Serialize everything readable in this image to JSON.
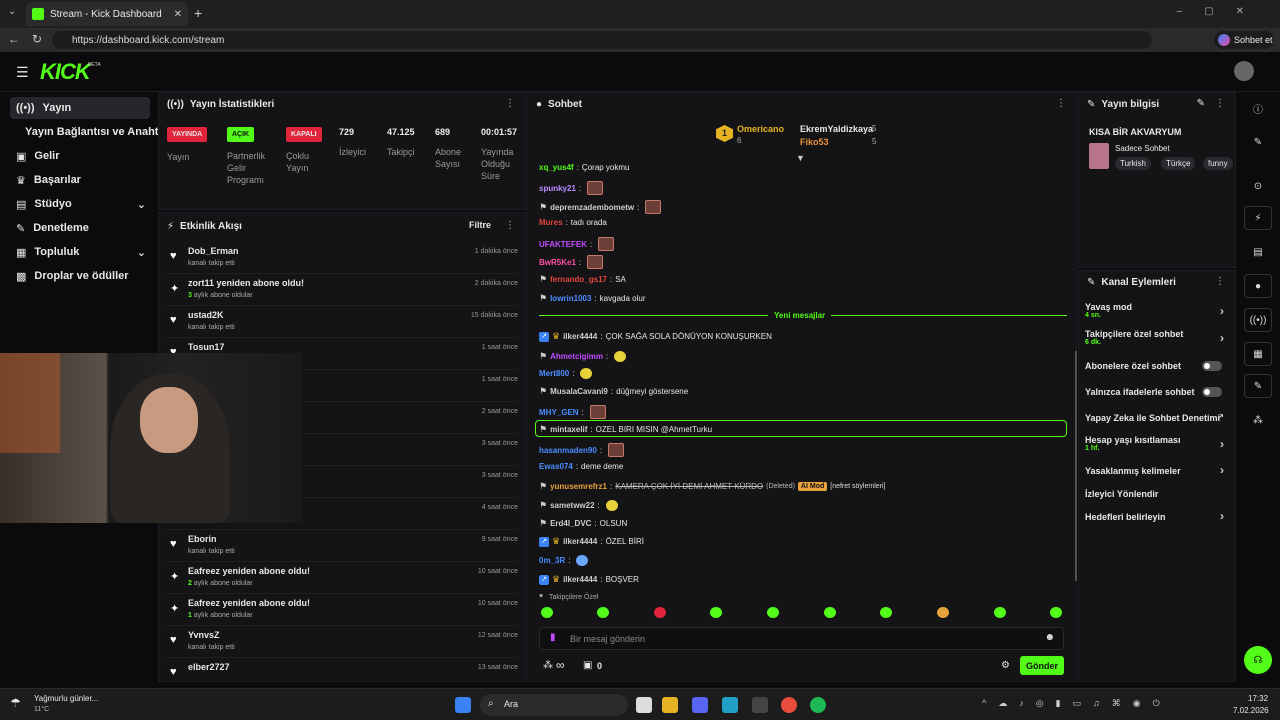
{
  "browser": {
    "tab_title": "Stream - Kick Dashboard",
    "url": "https://dashboard.kick.com/stream",
    "profile_label": "Sohbet et"
  },
  "brand": {
    "logo": "KICK",
    "beta": "BETA",
    "accent": "#53fc18"
  },
  "sidebar": {
    "items": [
      {
        "label": "Yayın",
        "icon": "broadcast-icon"
      },
      {
        "label": "Yayın Bağlantısı ve Anahtarı",
        "icon": ""
      },
      {
        "label": "Gelir",
        "icon": "revenue-icon"
      },
      {
        "label": "Başarılar",
        "icon": "trophy-icon"
      },
      {
        "label": "Stüdyo",
        "icon": "studio-icon"
      },
      {
        "label": "Denetleme",
        "icon": "wrench-icon"
      },
      {
        "label": "Topluluk",
        "icon": "community-icon"
      },
      {
        "label": "Droplar ve ödüller",
        "icon": "gift-icon"
      }
    ]
  },
  "stats": {
    "title": "Yayın İstatistikleri",
    "stream_badge": "YAYINDA",
    "stream_label": "Yayın",
    "partner_badge": "AÇIK",
    "partner_label": "Partnerlik Gelir Programı",
    "multi_badge": "KAPALI",
    "multi_label": "Çoklu Yayın",
    "viewers": "729",
    "viewers_label": "İzleyici",
    "followers": "47.125",
    "followers_label": "Takipçi",
    "subs": "689",
    "subs_label": "Abone Sayısı",
    "uptime": "00:01:57",
    "uptime_label": "Yayında Olduğu Süre"
  },
  "activity": {
    "title": "Etkinlik Akışı",
    "filter": "Filtre",
    "items": [
      {
        "name": "Dob_Erman",
        "sub": "kanalı takip etti",
        "time": "1 dakika önce",
        "icon": "heart"
      },
      {
        "name": "zort11 yeniden abone oldu!",
        "sub": "aylık abone oldular",
        "months": "3",
        "time": "2 dakika önce",
        "icon": "star"
      },
      {
        "name": "ustad2K",
        "sub": "kanalı takip etti",
        "time": "15 dakika önce",
        "icon": "heart"
      },
      {
        "name": "Tosun17",
        "sub": "",
        "time": "1 saat önce",
        "icon": "heart"
      },
      {
        "name": "",
        "sub": "",
        "time": "1 saat önce",
        "icon": "heart"
      },
      {
        "name": "",
        "sub": "",
        "time": "2 saat önce",
        "icon": "heart"
      },
      {
        "name": "",
        "sub": "",
        "time": "3 saat önce",
        "icon": "heart"
      },
      {
        "name": "",
        "sub": "",
        "time": "3 saat önce",
        "icon": "heart"
      },
      {
        "name": "",
        "sub": "",
        "time": "4 saat önce",
        "icon": "heart"
      },
      {
        "name": "Eborin",
        "sub": "kanalı takip etti",
        "time": "9 saat önce",
        "icon": "heart"
      },
      {
        "name": "Eafreez yeniden abone oldu!",
        "sub": "aylık abone oldular",
        "months": "2",
        "time": "10 saat önce",
        "icon": "star"
      },
      {
        "name": "Eafreez yeniden abone oldu!",
        "sub": "aylık abone oldular",
        "months": "1",
        "time": "10 saat önce",
        "icon": "star"
      },
      {
        "name": "YvnvsZ",
        "sub": "kanalı takip etti",
        "time": "12 saat önce",
        "icon": "heart"
      },
      {
        "name": "elber2727",
        "sub": "",
        "time": "13 saat önce",
        "icon": "heart"
      }
    ]
  },
  "chat": {
    "title": "Sohbet",
    "top": {
      "rank": "1",
      "first_name": "Omericano",
      "first_count": "6",
      "second_name": "EkremYaldizkaya",
      "second_count": "5",
      "third_name": "Fiko53",
      "third_count": "5"
    },
    "new_messages": "Yeni mesajlar",
    "messages": [
      {
        "user": "xq_yus4f",
        "text": "Çorap yokmu",
        "color": "#53fc18"
      },
      {
        "user": "spunky21",
        "text": "",
        "color": "#b98cff",
        "emote": "box"
      },
      {
        "user": "depremzadembometw",
        "text": "",
        "color": "#cfcfcf",
        "emote": "box",
        "badge": "mod"
      },
      {
        "user": "Mures",
        "text": "tadı orada",
        "color": "#e2453c"
      },
      {
        "user": "UFAKTEFEK",
        "text": "",
        "color": "#c04bff",
        "emote": "box"
      },
      {
        "user": "BwR5Ke1",
        "text": "",
        "color": "#ff4fa3",
        "emote": "box"
      },
      {
        "user": "fernando_gs17",
        "text": "SA",
        "color": "#e2453c",
        "badge": "mod"
      },
      {
        "user": "lowrin1003",
        "text": "kavgada olur",
        "color": "#4a8dff",
        "badge": "mod"
      },
      {
        "user": "ilker4444",
        "text": "ÇOK SAĞA SOLA DÖNÜYON KONUŞURKEN",
        "color": "#cfcfcf",
        "badge": "vip"
      },
      {
        "user": "Ahmetcigimm",
        "text": "",
        "color": "#c04bff",
        "emote": "yellow",
        "badge": "mod"
      },
      {
        "user": "Mert800",
        "text": "",
        "color": "#4a8dff",
        "emote": "yellow"
      },
      {
        "user": "MusalaCavani9",
        "text": "düğmeyi göstersene",
        "color": "#cfcfcf",
        "badge": "mod"
      },
      {
        "user": "MHY_GEN",
        "text": "",
        "color": "#4a8dff",
        "emote": "box"
      },
      {
        "user": "mintaxelif",
        "text": "OZEL BIRI MISIN @AhmetTurku",
        "color": "#cfcfcf",
        "badge": "mod",
        "highlight": true
      },
      {
        "user": "hasanmaden90",
        "text": "",
        "color": "#4a8dff",
        "emote": "box"
      },
      {
        "user": "Ewas074",
        "text": "deme deme",
        "color": "#4a8dff"
      },
      {
        "user": "yunusemrefrz1",
        "text": "KAMERA ÇOK İYİ DEMİ AHMET KÜRDO",
        "color": "#e8a33c",
        "deleted": "(Deleted)",
        "ai": "AI Mod",
        "reason": "[nefret söylemleri]",
        "badge": "mod"
      },
      {
        "user": "sametww22",
        "text": "",
        "color": "#cfcfcf",
        "emote": "yellow",
        "badge": "mod"
      },
      {
        "user": "Erd4l_DVC",
        "text": "OLSUN",
        "color": "#cfcfcf",
        "badge": "mod"
      },
      {
        "user": "ilker4444",
        "text": "ÖZEL BİRİ",
        "color": "#cfcfcf",
        "badge": "vip"
      },
      {
        "user": "0m_3R",
        "text": "",
        "color": "#4a8dff",
        "emote": "blue"
      },
      {
        "user": "ilker4444",
        "text": "BOŞVER",
        "color": "#cfcfcf",
        "badge": "vip"
      }
    ],
    "followers_only": "Takipçilere Özel",
    "placeholder": "Bir mesaj gönderin",
    "send": "Gönder",
    "infinity": "∞",
    "count": "0"
  },
  "info": {
    "title": "Yayın bilgisi",
    "stream_title": "KISA BİR AKVARYUM",
    "category": "Sadece Sohbet",
    "tags": [
      "Turkish",
      "Türkçe",
      "funny"
    ]
  },
  "actions": {
    "title": "Kanal Eylemleri",
    "items": [
      {
        "label": "Yavaş mod",
        "sub": "4 sn.",
        "type": "chevron"
      },
      {
        "label": "Takipçilere özel sohbet",
        "sub": "6 dk.",
        "type": "chevron"
      },
      {
        "label": "Abonelere özel sohbet",
        "sub": "",
        "type": "toggle"
      },
      {
        "label": "Yalnızca ifadelerle sohbet",
        "sub": "",
        "type": "toggle"
      },
      {
        "label": "Yapay Zeka ile Sohbet Denetimi",
        "sub": "",
        "type": "link"
      },
      {
        "label": "Hesap yaşı kısıtlaması",
        "sub": "1 hf.",
        "type": "chevron"
      },
      {
        "label": "Yasaklanmış kelimeler",
        "sub": "",
        "type": "chevron"
      },
      {
        "label": "İzleyici Yönlendir",
        "sub": "",
        "type": "none"
      },
      {
        "label": "Hedefleri belirleyin",
        "sub": "",
        "type": "chevron"
      }
    ]
  },
  "taskbar": {
    "weather": "Yağmurlu günler...",
    "temp": "11°C",
    "search": "Ara",
    "time": "17:32",
    "date": "7.02.2026"
  }
}
